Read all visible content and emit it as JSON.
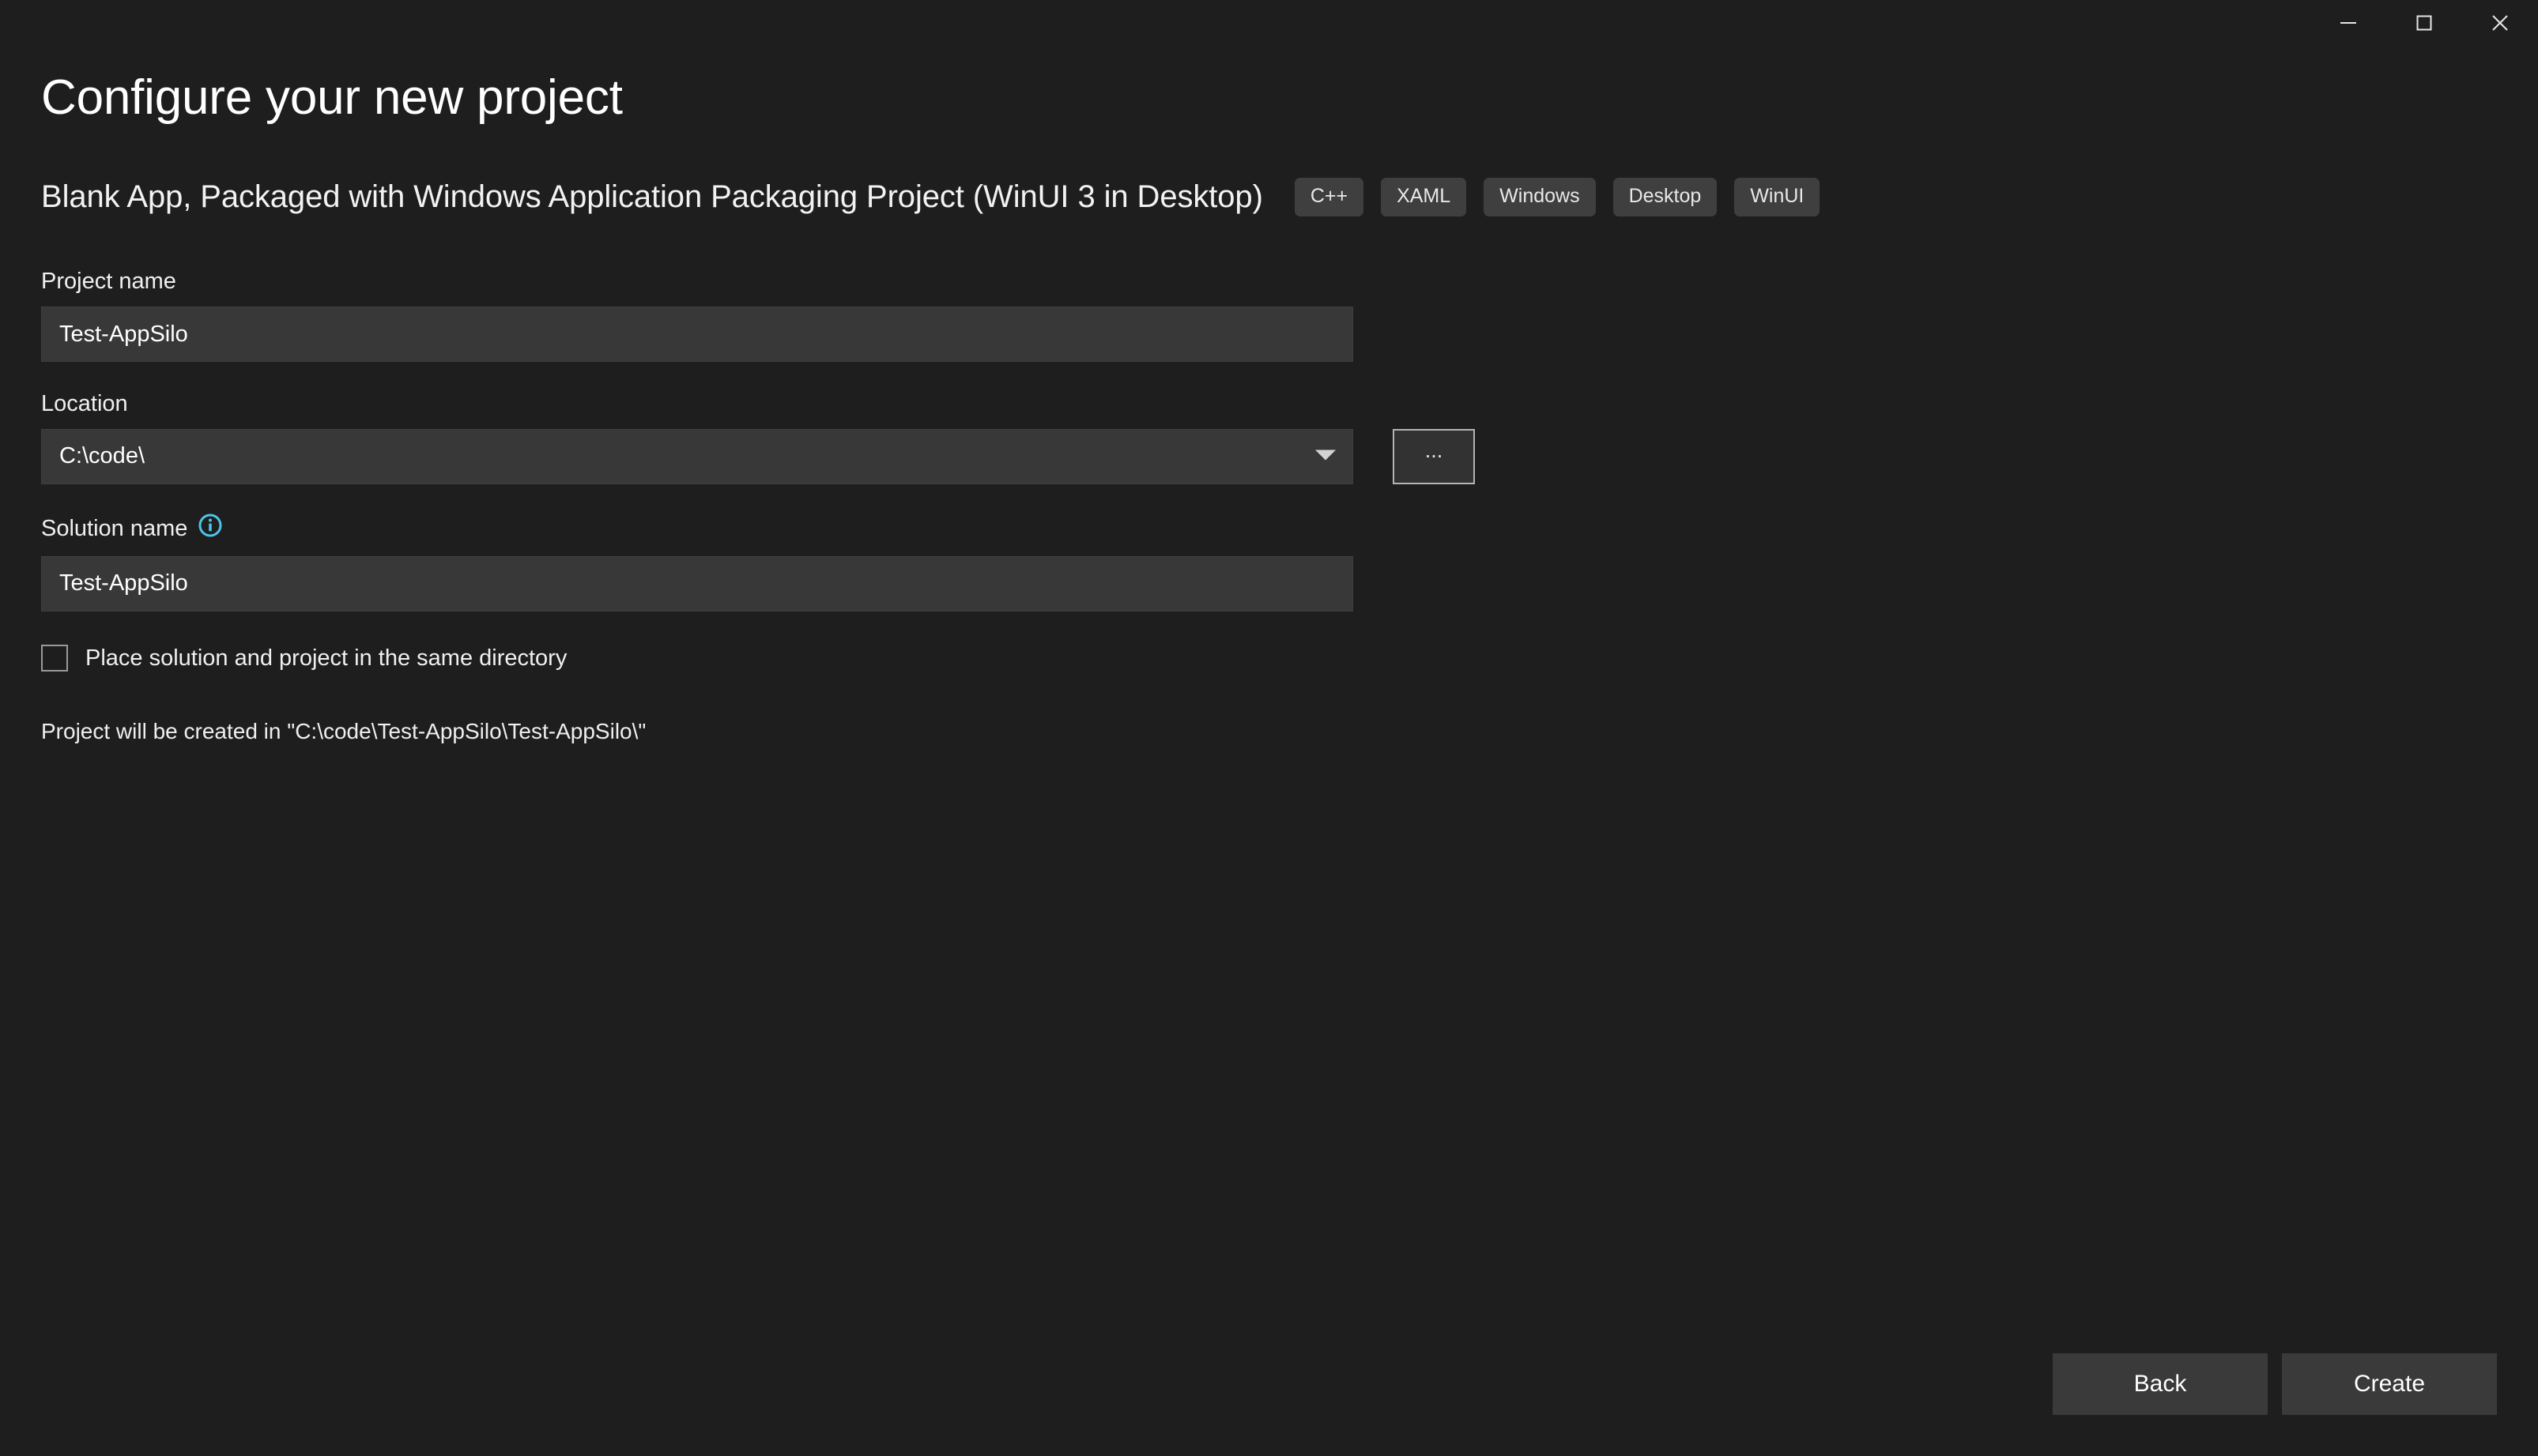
{
  "window": {
    "controls": [
      {
        "name": "minimize",
        "label": "Minimize"
      },
      {
        "name": "maximize",
        "label": "Maximize"
      },
      {
        "name": "close",
        "label": "Close"
      }
    ]
  },
  "header": {
    "title": "Configure your new project",
    "subtitle": "Blank App, Packaged with Windows Application Packaging Project (WinUI 3 in Desktop)",
    "tags": [
      "C++",
      "XAML",
      "Windows",
      "Desktop",
      "WinUI"
    ]
  },
  "form": {
    "project_name": {
      "label": "Project name",
      "value": "Test-AppSilo",
      "placeholder": ""
    },
    "location": {
      "label": "Location",
      "value": "C:\\code\\",
      "placeholder": "",
      "browse_label": "...",
      "dropdown_icon": "chevron-down-icon"
    },
    "solution_name": {
      "label": "Solution name",
      "value": "Test-AppSilo",
      "placeholder": "",
      "info_icon": "info-icon"
    },
    "same_directory": {
      "label": "Place solution and project in the same directory",
      "checked": false
    },
    "hint": "Project will be created in \"C:\\code\\Test-AppSilo\\Test-AppSilo\\\""
  },
  "footer": {
    "back_label": "Back",
    "create_label": "Create"
  },
  "colors": {
    "background": "#1e1e1e",
    "field_background": "#383838",
    "tag_background": "#3f3f3f",
    "button_background": "#3a3a3a",
    "info_accent": "#4ec3e8",
    "text": "#f0f0f0"
  }
}
